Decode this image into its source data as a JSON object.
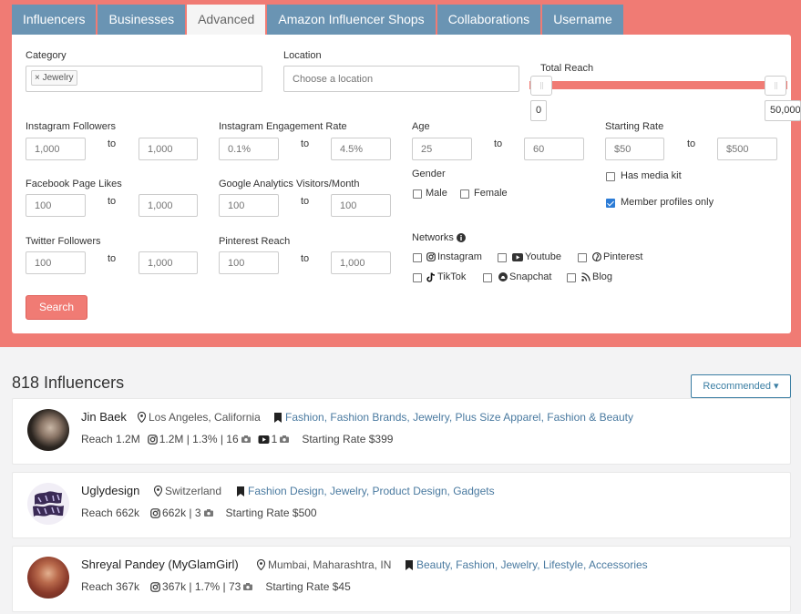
{
  "tabs": [
    {
      "label": "Influencers"
    },
    {
      "label": "Businesses"
    },
    {
      "label": "Advanced"
    },
    {
      "label": "Amazon Influencer Shops"
    },
    {
      "label": "Collaborations"
    },
    {
      "label": "Username"
    }
  ],
  "active_tab": "Advanced",
  "filters": {
    "category": {
      "label": "Category",
      "chip": "Jewelry",
      "chip_remove": "×"
    },
    "location": {
      "label": "Location",
      "placeholder": "Choose a location"
    },
    "total_reach": {
      "label": "Total Reach",
      "min": "0",
      "max": "50,000"
    },
    "instagram_followers": {
      "label": "Instagram Followers",
      "from": "1,000",
      "to": "1,000"
    },
    "instagram_engagement": {
      "label": "Instagram Engagement Rate",
      "from": "0.1%",
      "to": "4.5%"
    },
    "age": {
      "label": "Age",
      "from": "25",
      "to": "60"
    },
    "starting_rate": {
      "label": "Starting Rate",
      "from": "$50",
      "to": "$500"
    },
    "facebook_likes": {
      "label": "Facebook Page Likes",
      "from": "100",
      "to": "1,000"
    },
    "google_analytics": {
      "label": "Google Analytics Visitors/Month",
      "from": "100",
      "to": "100"
    },
    "twitter_followers": {
      "label": "Twitter Followers",
      "from": "100",
      "to": "1,000"
    },
    "pinterest_reach": {
      "label": "Pinterest Reach",
      "from": "100",
      "to": "1,000"
    },
    "to_label": "to",
    "gender": {
      "label": "Gender",
      "options": [
        "Male",
        "Female"
      ]
    },
    "has_media_kit": {
      "label": "Has media kit",
      "checked": false
    },
    "member_profiles_only": {
      "label": "Member profiles only",
      "checked": true
    },
    "networks": {
      "label": "Networks",
      "items": [
        {
          "label": "Instagram",
          "icon": "instagram-icon"
        },
        {
          "label": "Youtube",
          "icon": "youtube-icon"
        },
        {
          "label": "Pinterest",
          "icon": "pinterest-icon"
        },
        {
          "label": "TikTok",
          "icon": "tiktok-icon"
        },
        {
          "label": "Snapchat",
          "icon": "snapchat-icon"
        },
        {
          "label": "Blog",
          "icon": "rss-icon"
        }
      ]
    },
    "search_label": "Search"
  },
  "results": {
    "count_label": "818 Influencers",
    "sort_label": "Recommended ▾",
    "items": [
      {
        "name": "Jin Baek",
        "location": "Los Angeles, California",
        "categories": "Fashion, Fashion Brands, Jewelry, Plus Size Apparel, Fashion & Beauty",
        "reach": "Reach 1.2M",
        "instagram": "1.2M | 1.3% | 16",
        "youtube": "1",
        "rate": "Starting Rate $399"
      },
      {
        "name": "Uglydesign",
        "location": "Switzerland",
        "categories": "Fashion Design, Jewelry, Product Design, Gadgets",
        "reach": "Reach 662k",
        "instagram": "662k | 3",
        "rate": "Starting Rate $500"
      },
      {
        "name": "Shreyal Pandey (MyGlamGirl)",
        "location": "Mumbai, Maharashtra, IN",
        "categories": "Beauty, Fashion, Jewelry, Lifestyle, Accessories",
        "reach": "Reach 367k",
        "instagram": "367k | 1.7% | 73",
        "rate": "Starting Rate $45"
      }
    ]
  },
  "colors": {
    "brand": "#f07b74",
    "tab": "#6a94b3",
    "link": "#4a7aa0",
    "checkbox": "#2c7cd6"
  }
}
